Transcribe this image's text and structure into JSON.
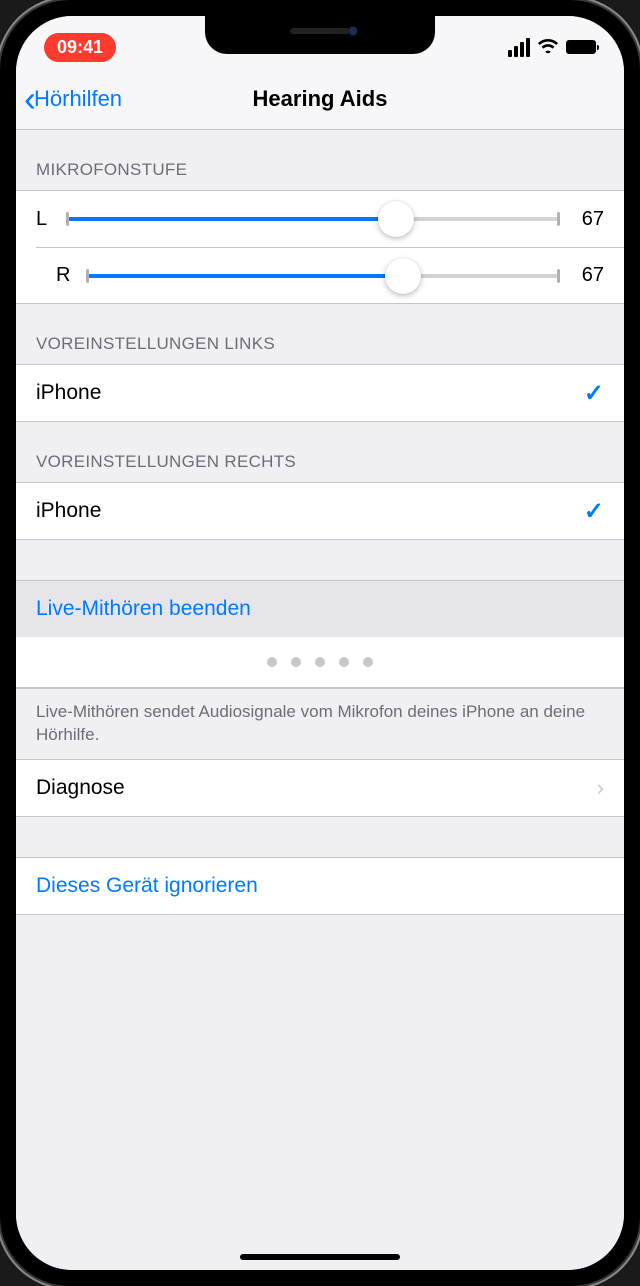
{
  "status_bar": {
    "time": "09:41"
  },
  "nav": {
    "back_label": "Hörhilfen",
    "title": "Hearing Aids"
  },
  "mic_level": {
    "header": "MIKROFONSTUFE",
    "left_label": "L",
    "left_value": "67",
    "left_pct": 67,
    "right_label": "R",
    "right_value": "67",
    "right_pct": 67
  },
  "preset_left": {
    "header": "VOREINSTELLUNGEN LINKS",
    "option": "iPhone"
  },
  "preset_right": {
    "header": "VOREINSTELLUNGEN RECHTS",
    "option": "iPhone"
  },
  "live_listen": {
    "stop_label": "Live-Mithören beenden",
    "description": "Live-Mithören sendet Audiosignale vom Mikrofon deines iPhone an deine Hörhilfe."
  },
  "diagnose_label": "Diagnose",
  "forget_label": "Dieses Gerät ignorieren"
}
